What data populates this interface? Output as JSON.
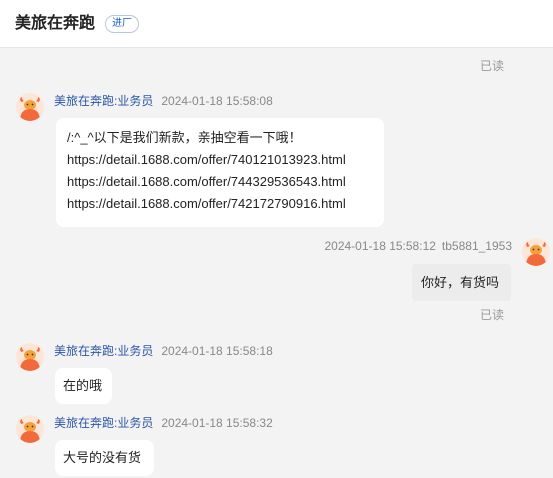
{
  "header": {
    "shop_name": "美旅在奔跑",
    "badge": "进厂"
  },
  "read_label": "已读",
  "messages": [
    {
      "sender": "美旅在奔跑:业务员",
      "time": "2024-01-18 15:58:08",
      "lines": [
        "/:^_^以下是我们新款，亲抽空看一下哦！",
        "https://detail.1688.com/offer/740121013923.html",
        "https://detail.1688.com/offer/744329536543.html",
        "https://detail.1688.com/offer/742172790916.html"
      ]
    },
    {
      "sender": "tb5881_1953",
      "time": "2024-01-18 15:58:12",
      "text": "你好，有货吗"
    },
    {
      "sender": "美旅在奔跑:业务员",
      "time": "2024-01-18 15:58:18",
      "text": "在的哦"
    },
    {
      "sender": "美旅在奔跑:业务员",
      "time": "2024-01-18 15:58:32",
      "text": "大号的没有货"
    }
  ],
  "colors": {
    "background": "#f3f3f3",
    "sender_name": "#2b57a8",
    "badge_text": "#1c5fc4",
    "avatar_bull": "#f26a3c"
  }
}
